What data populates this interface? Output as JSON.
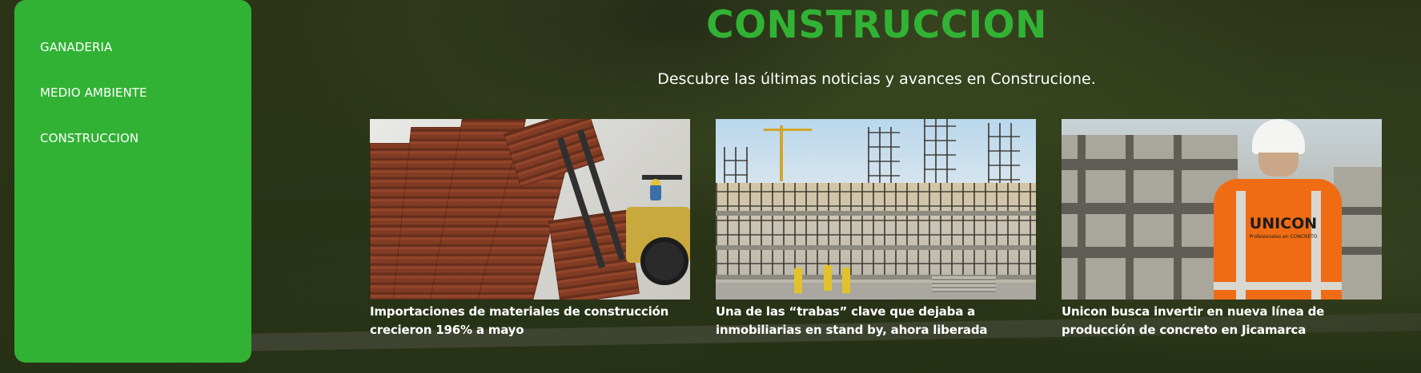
{
  "sidebar": {
    "items": [
      {
        "label": "GANADERIA"
      },
      {
        "label": "MEDIO AMBIENTE"
      },
      {
        "label": "CONSTRUCCION"
      }
    ]
  },
  "header": {
    "title": "CONSTRUCCION",
    "subtitle": "Descubre las últimas noticias y avances en Construcione."
  },
  "articles": [
    {
      "caption": "Importaciones de materiales de construcción crecieron 196% a mayo"
    },
    {
      "caption": "Una de las “trabas” clave que dejaba a inmobiliarias en stand by, ahora liberada"
    },
    {
      "caption": "Unicon busca invertir en nueva línea de producción de concreto en Jicamarca",
      "image_text": "UNICON",
      "image_subtext": "Profesionales en CONCRETO"
    }
  ],
  "colors": {
    "accent": "#31b234",
    "text_light": "#ffffff"
  }
}
